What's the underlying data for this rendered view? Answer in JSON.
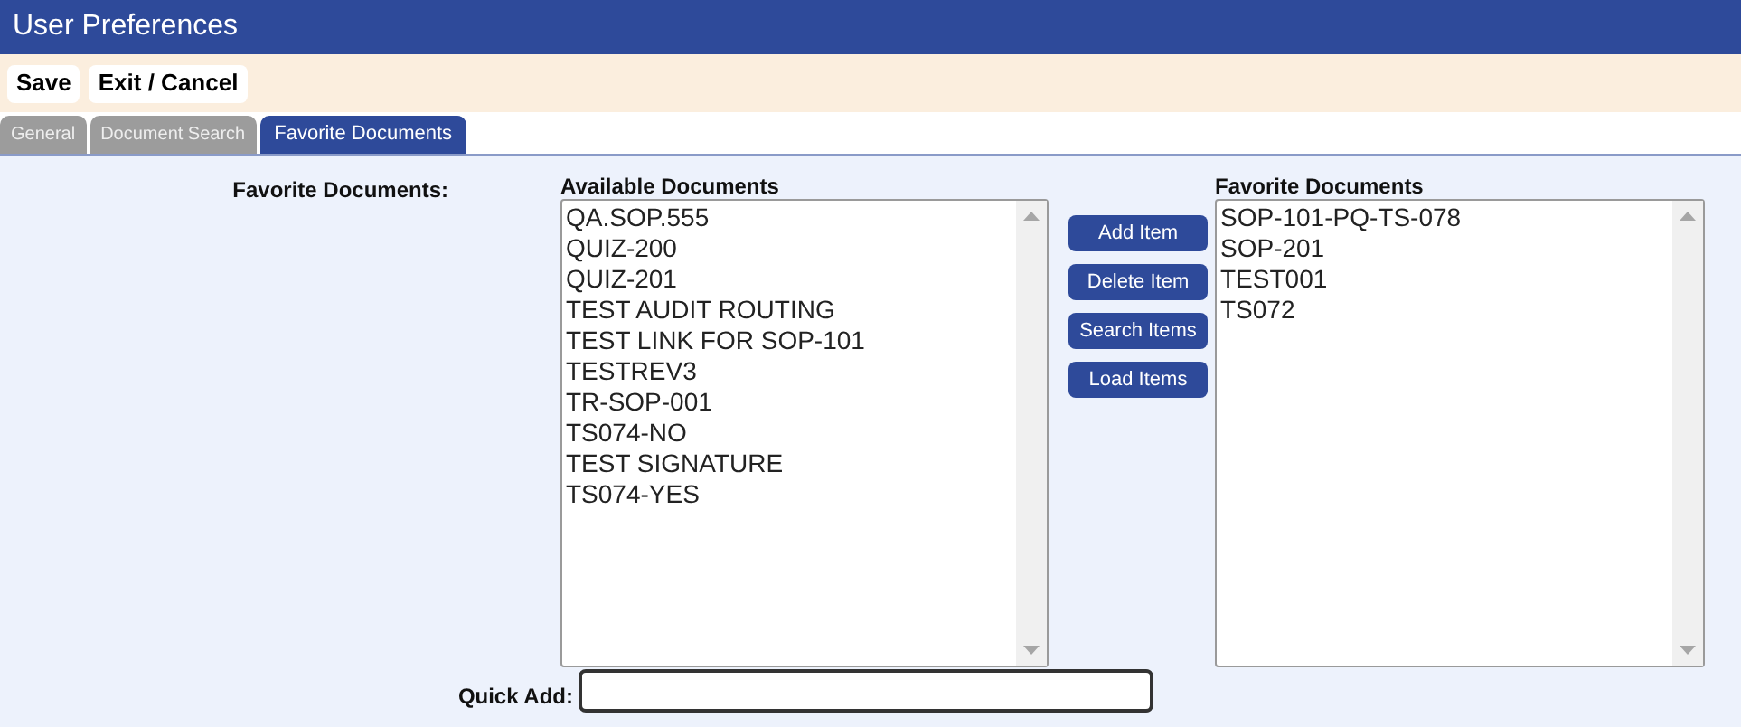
{
  "window": {
    "title": "User Preferences"
  },
  "toolbar": [
    "Save",
    "Exit / Cancel"
  ],
  "tabs": [
    {
      "label": "General",
      "selected": false
    },
    {
      "label": "Document Search",
      "selected": false
    },
    {
      "label": "Favorite Documents",
      "selected": true
    }
  ],
  "form": {
    "label": "Favorite Documents:",
    "available": {
      "heading": "Available Documents",
      "items": [
        "QA.SOP.555",
        "QUIZ-200",
        "QUIZ-201",
        "TEST AUDIT ROUTING",
        "TEST LINK FOR SOP-101",
        "TESTREV3",
        "TR-SOP-001",
        "TS074-NO",
        "TEST SIGNATURE",
        "TS074-YES"
      ]
    },
    "actions": [
      "Add Item",
      "Delete Item",
      "Search Items",
      "Load Items"
    ],
    "favorites": {
      "heading": "Favorite Documents",
      "items": [
        "SOP-101-PQ-TS-078",
        "SOP-201",
        "TEST001",
        "TS072"
      ]
    },
    "quick_add": {
      "label": "Quick Add:"
    }
  }
}
